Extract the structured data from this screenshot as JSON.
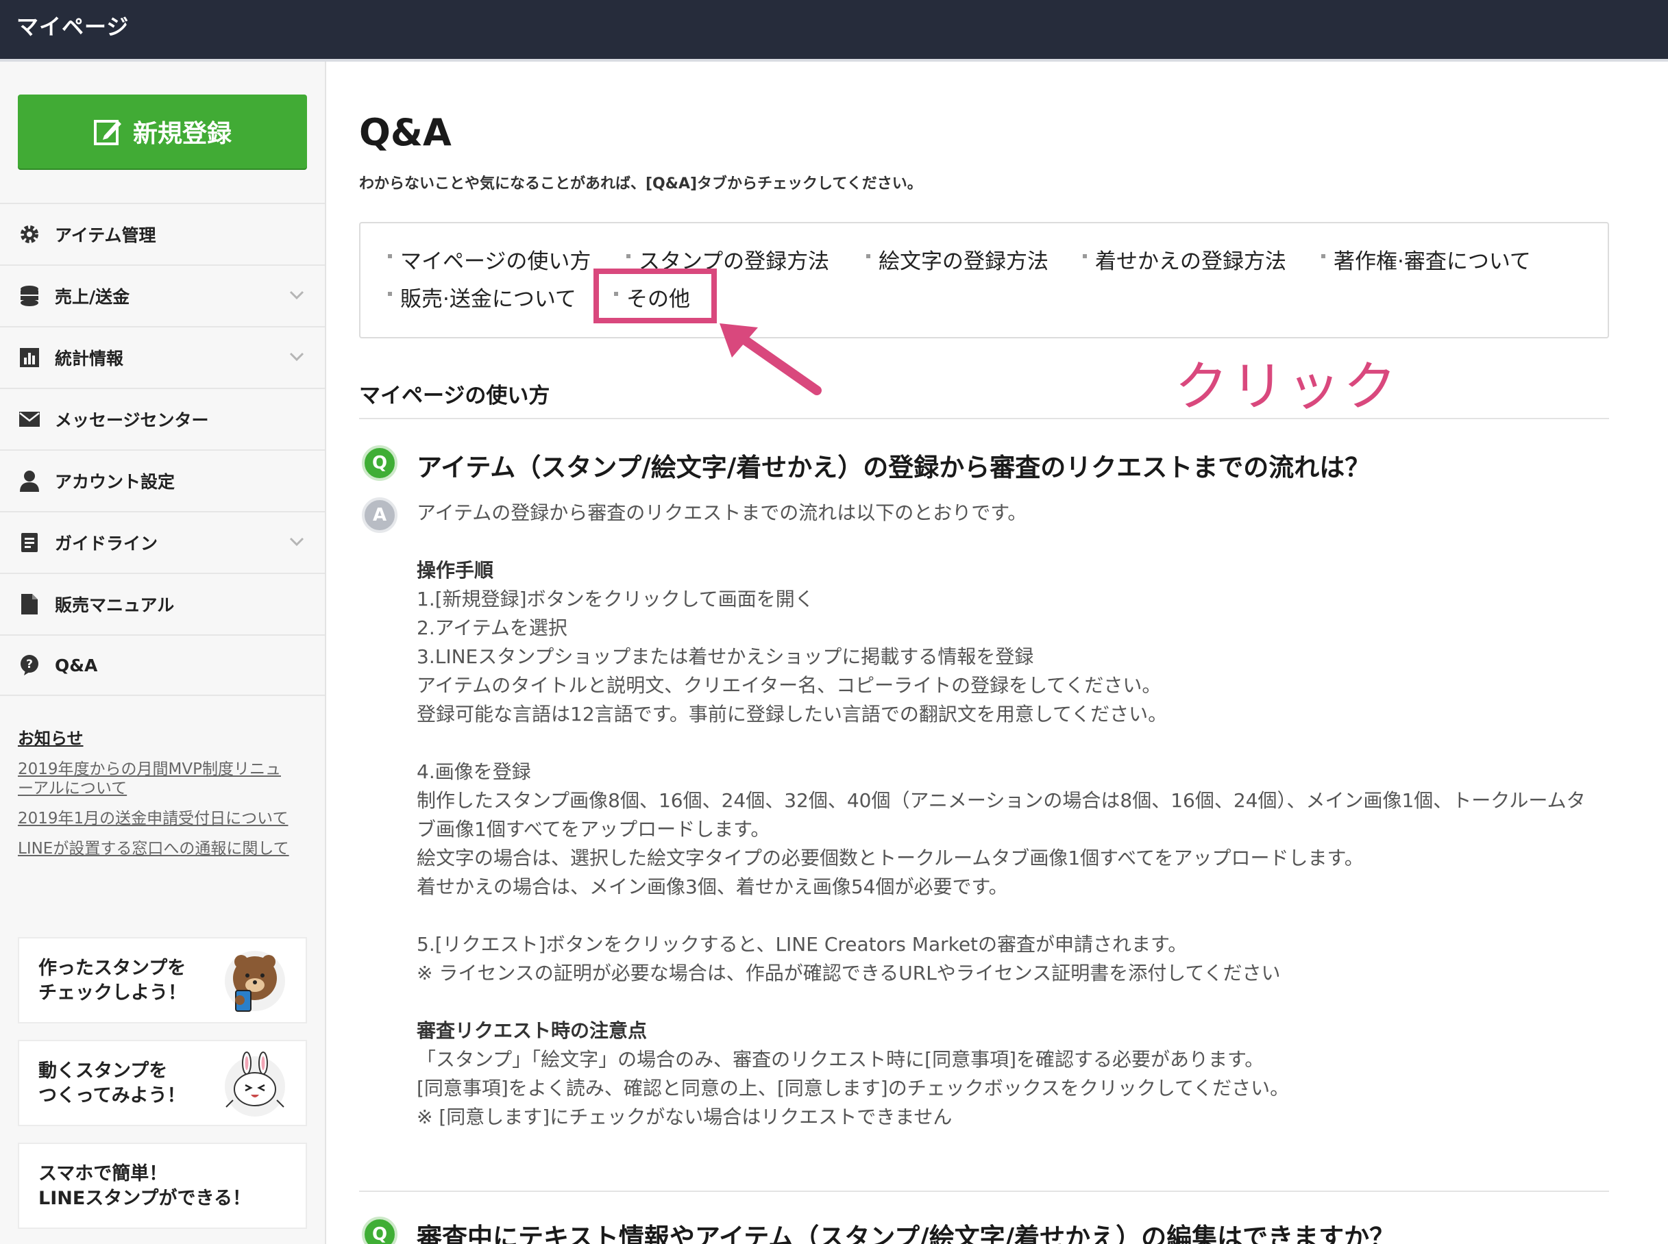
{
  "header": {
    "title": "マイページ"
  },
  "sidebar": {
    "new_button": "新規登録",
    "items": [
      {
        "label": "アイテム管理",
        "icon": "gear-icon",
        "has_chevron": false
      },
      {
        "label": "売上/送金",
        "icon": "coins-icon",
        "has_chevron": true
      },
      {
        "label": "統計情報",
        "icon": "bar-chart-icon",
        "has_chevron": true
      },
      {
        "label": "メッセージセンター",
        "icon": "envelope-icon",
        "has_chevron": false
      },
      {
        "label": "アカウント設定",
        "icon": "user-icon",
        "has_chevron": false
      },
      {
        "label": "ガイドライン",
        "icon": "document-icon",
        "has_chevron": true
      },
      {
        "label": "販売マニュアル",
        "icon": "file-icon",
        "has_chevron": false
      },
      {
        "label": "Q&A",
        "icon": "question-bubble-icon",
        "has_chevron": false
      }
    ],
    "news": {
      "heading": "お知らせ",
      "links": [
        "2019年度からの月間MVP制度リニュ",
        "ーアルについて",
        "2019年1月の送金申請受付日について",
        "LINEが設置する窓口への通報に関して"
      ]
    },
    "banners": [
      {
        "line1": "作ったスタンプを",
        "line2": "チェックしよう！"
      },
      {
        "line1": "動くスタンプを",
        "line2": "つくってみよう！"
      },
      {
        "line1": "スマホで簡単！",
        "line2": "LINEスタンプができる！"
      }
    ]
  },
  "main": {
    "title": "Q&A",
    "subtitle": "わからないことや気になることがあれば、[Q&A]タブからチェックしてください。",
    "tabs": [
      "マイページの使い方",
      "スタンプの登録方法",
      "絵文字の登録方法",
      "着せかえの登録方法",
      "著作権·審査について",
      "販売·送金について",
      "その他"
    ],
    "annotation": "クリック",
    "section_title": "マイページの使い方",
    "qa": [
      {
        "q_badge": "Q",
        "a_badge": "A",
        "question": "アイテム（スタンプ/絵文字/着せかえ）の登録から審査のリクエストまでの流れは？",
        "answer": {
          "intro": "アイテムの登録から審査のリクエストまでの流れは以下のとおりです。",
          "steps_heading": "操作手順",
          "step1": "1.[新規登録]ボタンをクリックして画面を開く",
          "step2": "2.アイテムを選択",
          "step3": "3.LINEスタンプショップまたは着せかえショップに掲載する情報を登録",
          "step3_a": "アイテムのタイトルと説明文、クリエイター名、コピーライトの登録をしてください。",
          "step3_b": "登録可能な言語は12言語です。事前に登録したい言語での翻訳文を用意してください。",
          "step4": "4.画像を登録",
          "step4_a": "制作したスタンプ画像8個、16個、24個、32個、40個（アニメーションの場合は8個、16個、24個）、メイン画像1個、トークルームタ",
          "step4_b": "ブ画像1個すべてをアップロードします。",
          "step4_c": "絵文字の場合は、選択した絵文字タイプの必要個数とトークルームタブ画像1個すべてをアップロードします。",
          "step4_d": "着せかえの場合は、メイン画像3個、着せかえ画像54個が必要です。",
          "step5": "5.[リクエスト]ボタンをクリックすると、LINE Creators Marketの審査が申請されます。",
          "step5_note": "※ ライセンスの証明が必要な場合は、作品が確認できるURLやライセンス証明書を添付してください",
          "notes_heading": "審査リクエスト時の注意点",
          "note1": "「スタンプ」「絵文字」の場合のみ、審査のリクエスト時に[同意事項]を確認する必要があります。",
          "note2": "[同意事項]をよく読み、確認と同意の上、[同意します]のチェックボックスをクリックしてください。",
          "note3": "※ [同意します]にチェックがない場合はリクエストできません"
        }
      },
      {
        "q_badge": "Q",
        "question": "審査中にテキスト情報やアイテム（スタンプ/絵文字/着せかえ）の編集はできますか？"
      }
    ]
  },
  "colors": {
    "header_bg": "#262c3b",
    "green": "#41ab35",
    "accent_pink": "#d9487d",
    "sidebar_bg": "#f7f7f7"
  }
}
